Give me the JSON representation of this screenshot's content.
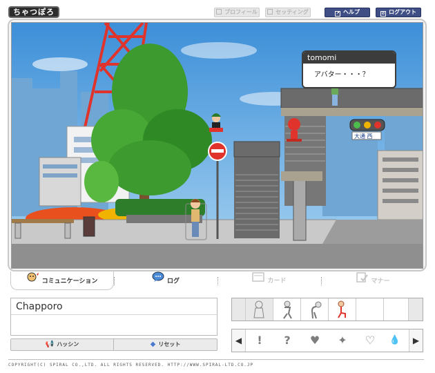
{
  "header": {
    "logo": "ちゃつぽろ",
    "profile_label": "プロフィール",
    "settings_label": "セッティング",
    "help_label": "ヘルプ",
    "logout_label": "ログアウト"
  },
  "scene": {
    "bubble_user": "tomomi",
    "bubble_message": "アバター・・・？",
    "street_sign": "大通 西"
  },
  "tabs": [
    {
      "label": "コミュニケーション",
      "active": true
    },
    {
      "label": "ログ",
      "active": false
    },
    {
      "label": "カード",
      "active": false,
      "disabled": true
    },
    {
      "label": "マナー",
      "active": false,
      "disabled": true
    }
  ],
  "chat": {
    "input_value": "Chapporo",
    "send_label": "ハッシン",
    "reset_label": "リセット"
  },
  "actions_panel": {
    "poses": [
      "stand-pose-icon",
      "walk-pose-icon",
      "bow-pose-icon",
      "sit-pose-icon"
    ]
  },
  "emotion_panel": {
    "left_arrow": "◀",
    "right_arrow": "▶",
    "emotes": [
      "!",
      "?",
      "♥",
      "✦",
      "♡",
      "💧"
    ]
  },
  "footer": {
    "copyright": "COPYRIGHT(C) SPIRAL CO.,LTD. ALL RIGHTS RESERVED.  HTTP://WWW.SPIRAL-LTD.CO.JP"
  },
  "colors": {
    "sky": "#5aa6e0",
    "tower_red": "#e0332b",
    "tree_green": "#3d9a2e",
    "header_active": "#3f4f86"
  }
}
